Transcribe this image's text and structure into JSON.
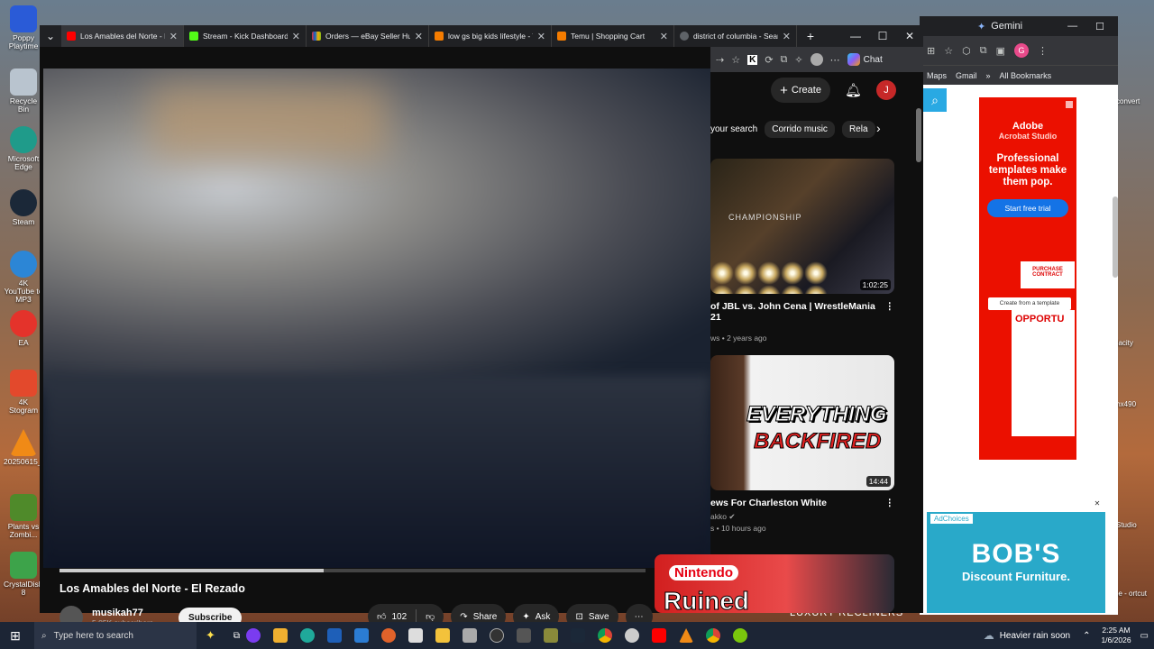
{
  "desktop": {
    "left_icons": [
      {
        "label": "Poppy Playtime",
        "color": "#2a5bd7"
      },
      {
        "label": "Recycle Bin",
        "color": "#b9c4cf"
      },
      {
        "label": "Microsoft Edge",
        "color": "#1f9b8a"
      },
      {
        "label": "Steam",
        "color": "#1b2838"
      },
      {
        "label": "4K YouTube to MP3",
        "color": "#2c86d6"
      },
      {
        "label": "EA",
        "color": "#e4332b"
      },
      {
        "label": "4K Stogram",
        "color": "#e3492c"
      },
      {
        "label": "20250615_1...",
        "color": "#f08a16"
      },
      {
        "label": "Plants vs Zombi...",
        "color": "#4f8a2a"
      },
      {
        "label": "CrystalDisk... 8",
        "color": "#3da34a"
      }
    ],
    "right_icons": [
      {
        "label": "convert"
      },
      {
        "label": "dacity"
      },
      {
        "label": "mx490"
      },
      {
        "label": "Studio"
      },
      {
        "label": "pe - ortcut"
      }
    ]
  },
  "bg_browser": {
    "gemini_label": "Gemini",
    "bookmarks": [
      "Maps",
      "Gmail",
      "All Bookmarks"
    ],
    "avatar_letter": "G"
  },
  "browser": {
    "tabs": [
      {
        "label": "Los Amables del Norte - El",
        "favicon_color": "#ff0000",
        "active": true
      },
      {
        "label": "Stream - Kick Dashboard",
        "favicon_color": "#53fc18",
        "active": false
      },
      {
        "label": "Orders — eBay Seller Hub",
        "favicon_color": "#e53238",
        "active": false
      },
      {
        "label": "low gs big kids lifestyle - Te",
        "favicon_color": "#f57c00",
        "active": false
      },
      {
        "label": "Temu | Shopping Cart",
        "favicon_color": "#f57c00",
        "active": false
      },
      {
        "label": "district of columbia - Searc",
        "favicon_color": "#5f6368",
        "active": false
      }
    ],
    "new_tab_symbol": "+",
    "chat_label": "Chat",
    "window_buttons": [
      "—",
      "☐",
      "✕"
    ]
  },
  "youtube": {
    "create_label": "Create",
    "avatar_letter": "J",
    "chips": [
      "your search",
      "Corrido music",
      "Rela"
    ],
    "video": {
      "title": "Los Amables del Norte - El Rezado",
      "channel": "musikah77",
      "subscribers": "5.05K subscribers",
      "subscribe_label": "Subscribe",
      "likes": "102",
      "share_label": "Share",
      "ask_label": "Ask",
      "save_label": "Save"
    },
    "sidebar": [
      {
        "title": "of JBL vs. John Cena | WrestleMania 21",
        "meta": "ws • 2 years ago",
        "duration": "1:02:25",
        "channel": ""
      },
      {
        "title": "ews For Charleston White",
        "channel": "akko",
        "meta": "s • 10 hours ago",
        "duration": "14:44",
        "thumb_text_1": "EVERYTHING",
        "thumb_text_2": "BACKFIRED"
      },
      {
        "title": "",
        "thumb_text_1": "Nintendo",
        "thumb_text_2": "Ruined"
      }
    ],
    "thumb1_text": "CHAMPIONSHIP"
  },
  "ads": {
    "adobe": {
      "brand": "Adobe",
      "product": "Acrobat Studio",
      "headline": "Professional templates make them pop.",
      "cta": "Start free trial",
      "doc_label_1": "PURCHASE CONTRACT",
      "template_label": "Create from a template",
      "doc_label_2": "OPPORTU"
    },
    "bobs": {
      "adchoices": "AdChoices",
      "brand": "BOB'S",
      "tagline": "Discount Furniture.",
      "bottom_text": "LUXURY RECLINERS"
    }
  },
  "taskbar": {
    "search_placeholder": "Type here to search",
    "weather": "Heavier rain soon",
    "time": "2:25 AM",
    "date": "1/6/2026",
    "icons": [
      "task-view-icon",
      "cortana-icon",
      "file-explorer-icon",
      "edge-icon",
      "mail-icon",
      "word-icon",
      "firefox-icon",
      "folder-icon",
      "app-icon",
      "obs-icon",
      "calculator-icon",
      "game-icon",
      "steam-icon",
      "chrome-icon",
      "app2-icon",
      "youtube-icon",
      "vlc-icon",
      "chrome2-icon",
      "app3-icon"
    ]
  }
}
